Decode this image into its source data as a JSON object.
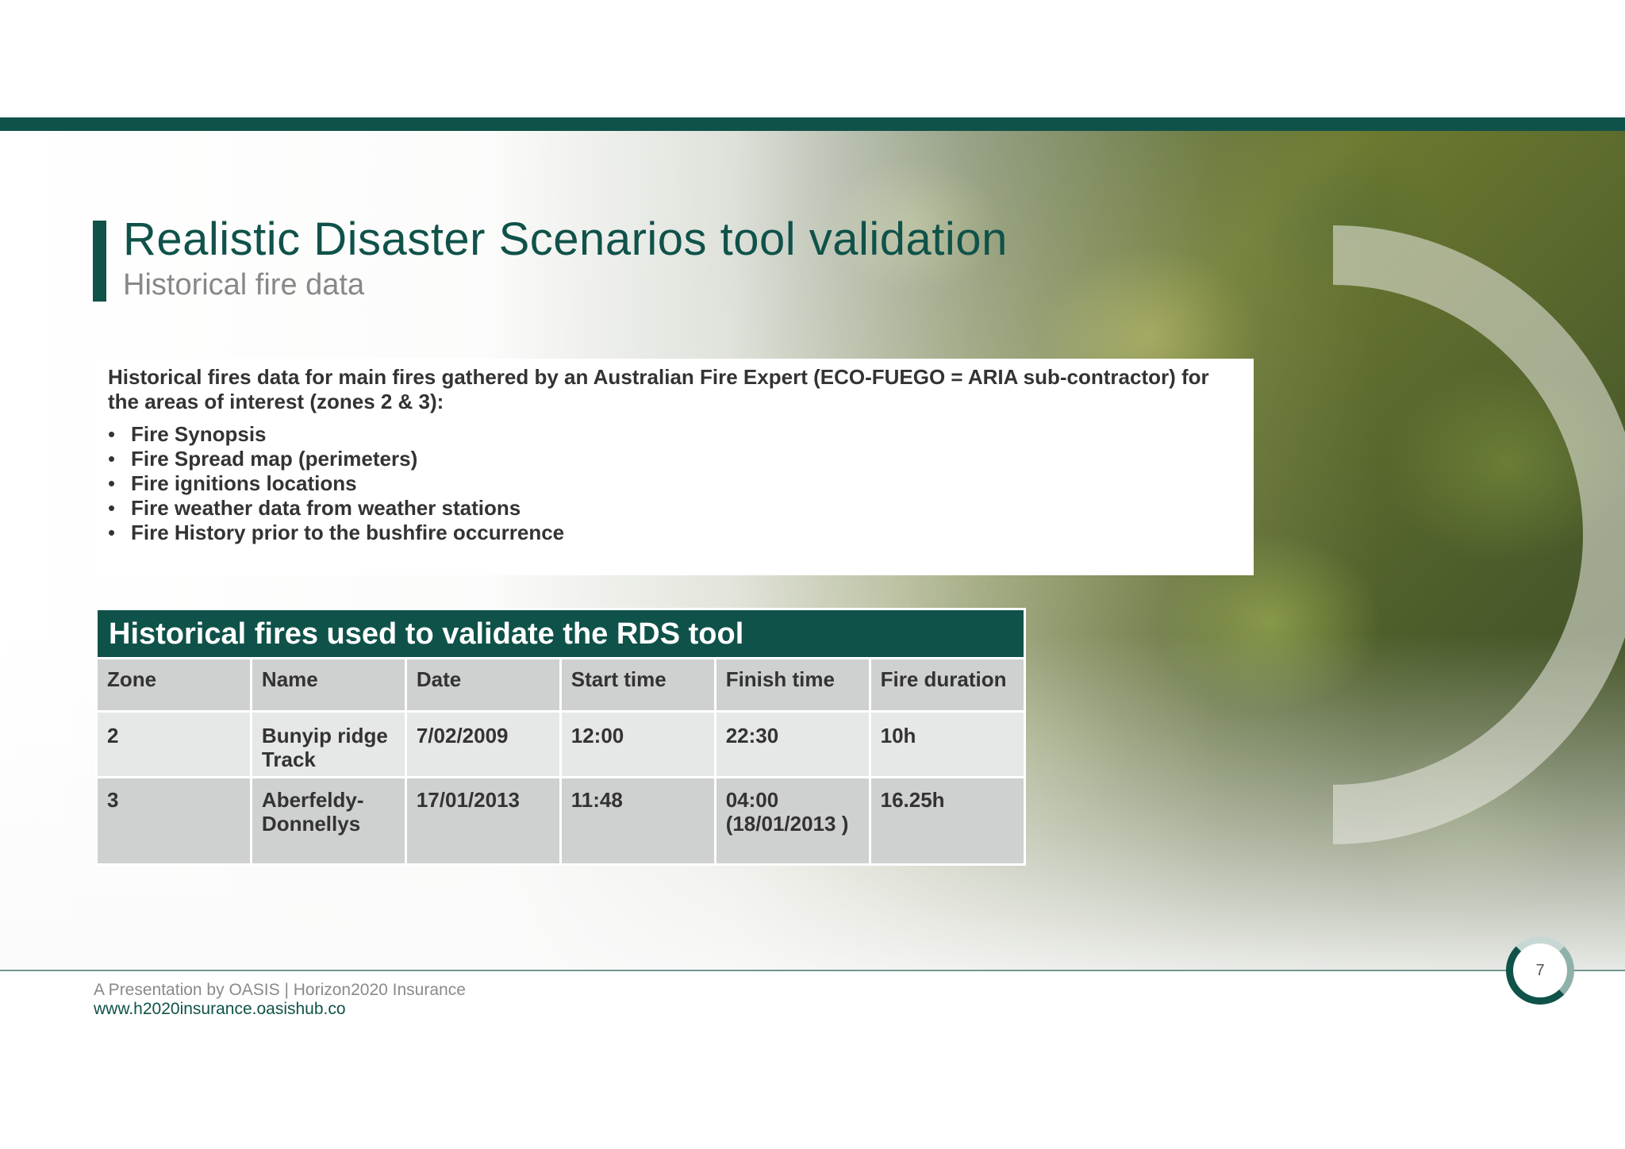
{
  "header": {
    "title": "Realistic Disaster Scenarios tool validation",
    "subtitle": "Historical fire data"
  },
  "intro": {
    "text": "Historical fires data for main fires gathered by an Australian Fire Expert (ECO-FUEGO = ARIA sub-contractor) for the areas of interest (zones 2 & 3):",
    "bullet_symbol": "•",
    "bullets": [
      "Fire Synopsis",
      "Fire Spread map (perimeters)",
      "Fire ignitions locations",
      "Fire weather data from weather stations",
      "Fire History prior to the bushfire occurrence"
    ]
  },
  "table": {
    "caption": "Historical fires used to validate the RDS tool",
    "columns": [
      "Zone",
      "Name",
      "Date",
      "Start time",
      "Finish time",
      "Fire duration"
    ],
    "rows": [
      [
        "2",
        "Bunyip ridge Track",
        "7/02/2009",
        "12:00",
        "22:30",
        "10h"
      ],
      [
        "3",
        "Aberfeldy-Donnellys",
        "17/01/2013",
        "11:48",
        "04:00 (18/01/2013 )",
        "16.25h"
      ]
    ]
  },
  "footer": {
    "text": "A Presentation by OASIS | Horizon2020 Insurance",
    "url": "www.h2020insurance.oasishub.co",
    "page_number": "7"
  },
  "colors": {
    "brand_teal": "#0f5249",
    "table_header_gray": "#cfd0d0",
    "table_row_light": "#e6e7e7",
    "text_dark": "#333333",
    "subtitle_gray": "#888888"
  },
  "background": {
    "image": "forest-aerial-photo"
  }
}
